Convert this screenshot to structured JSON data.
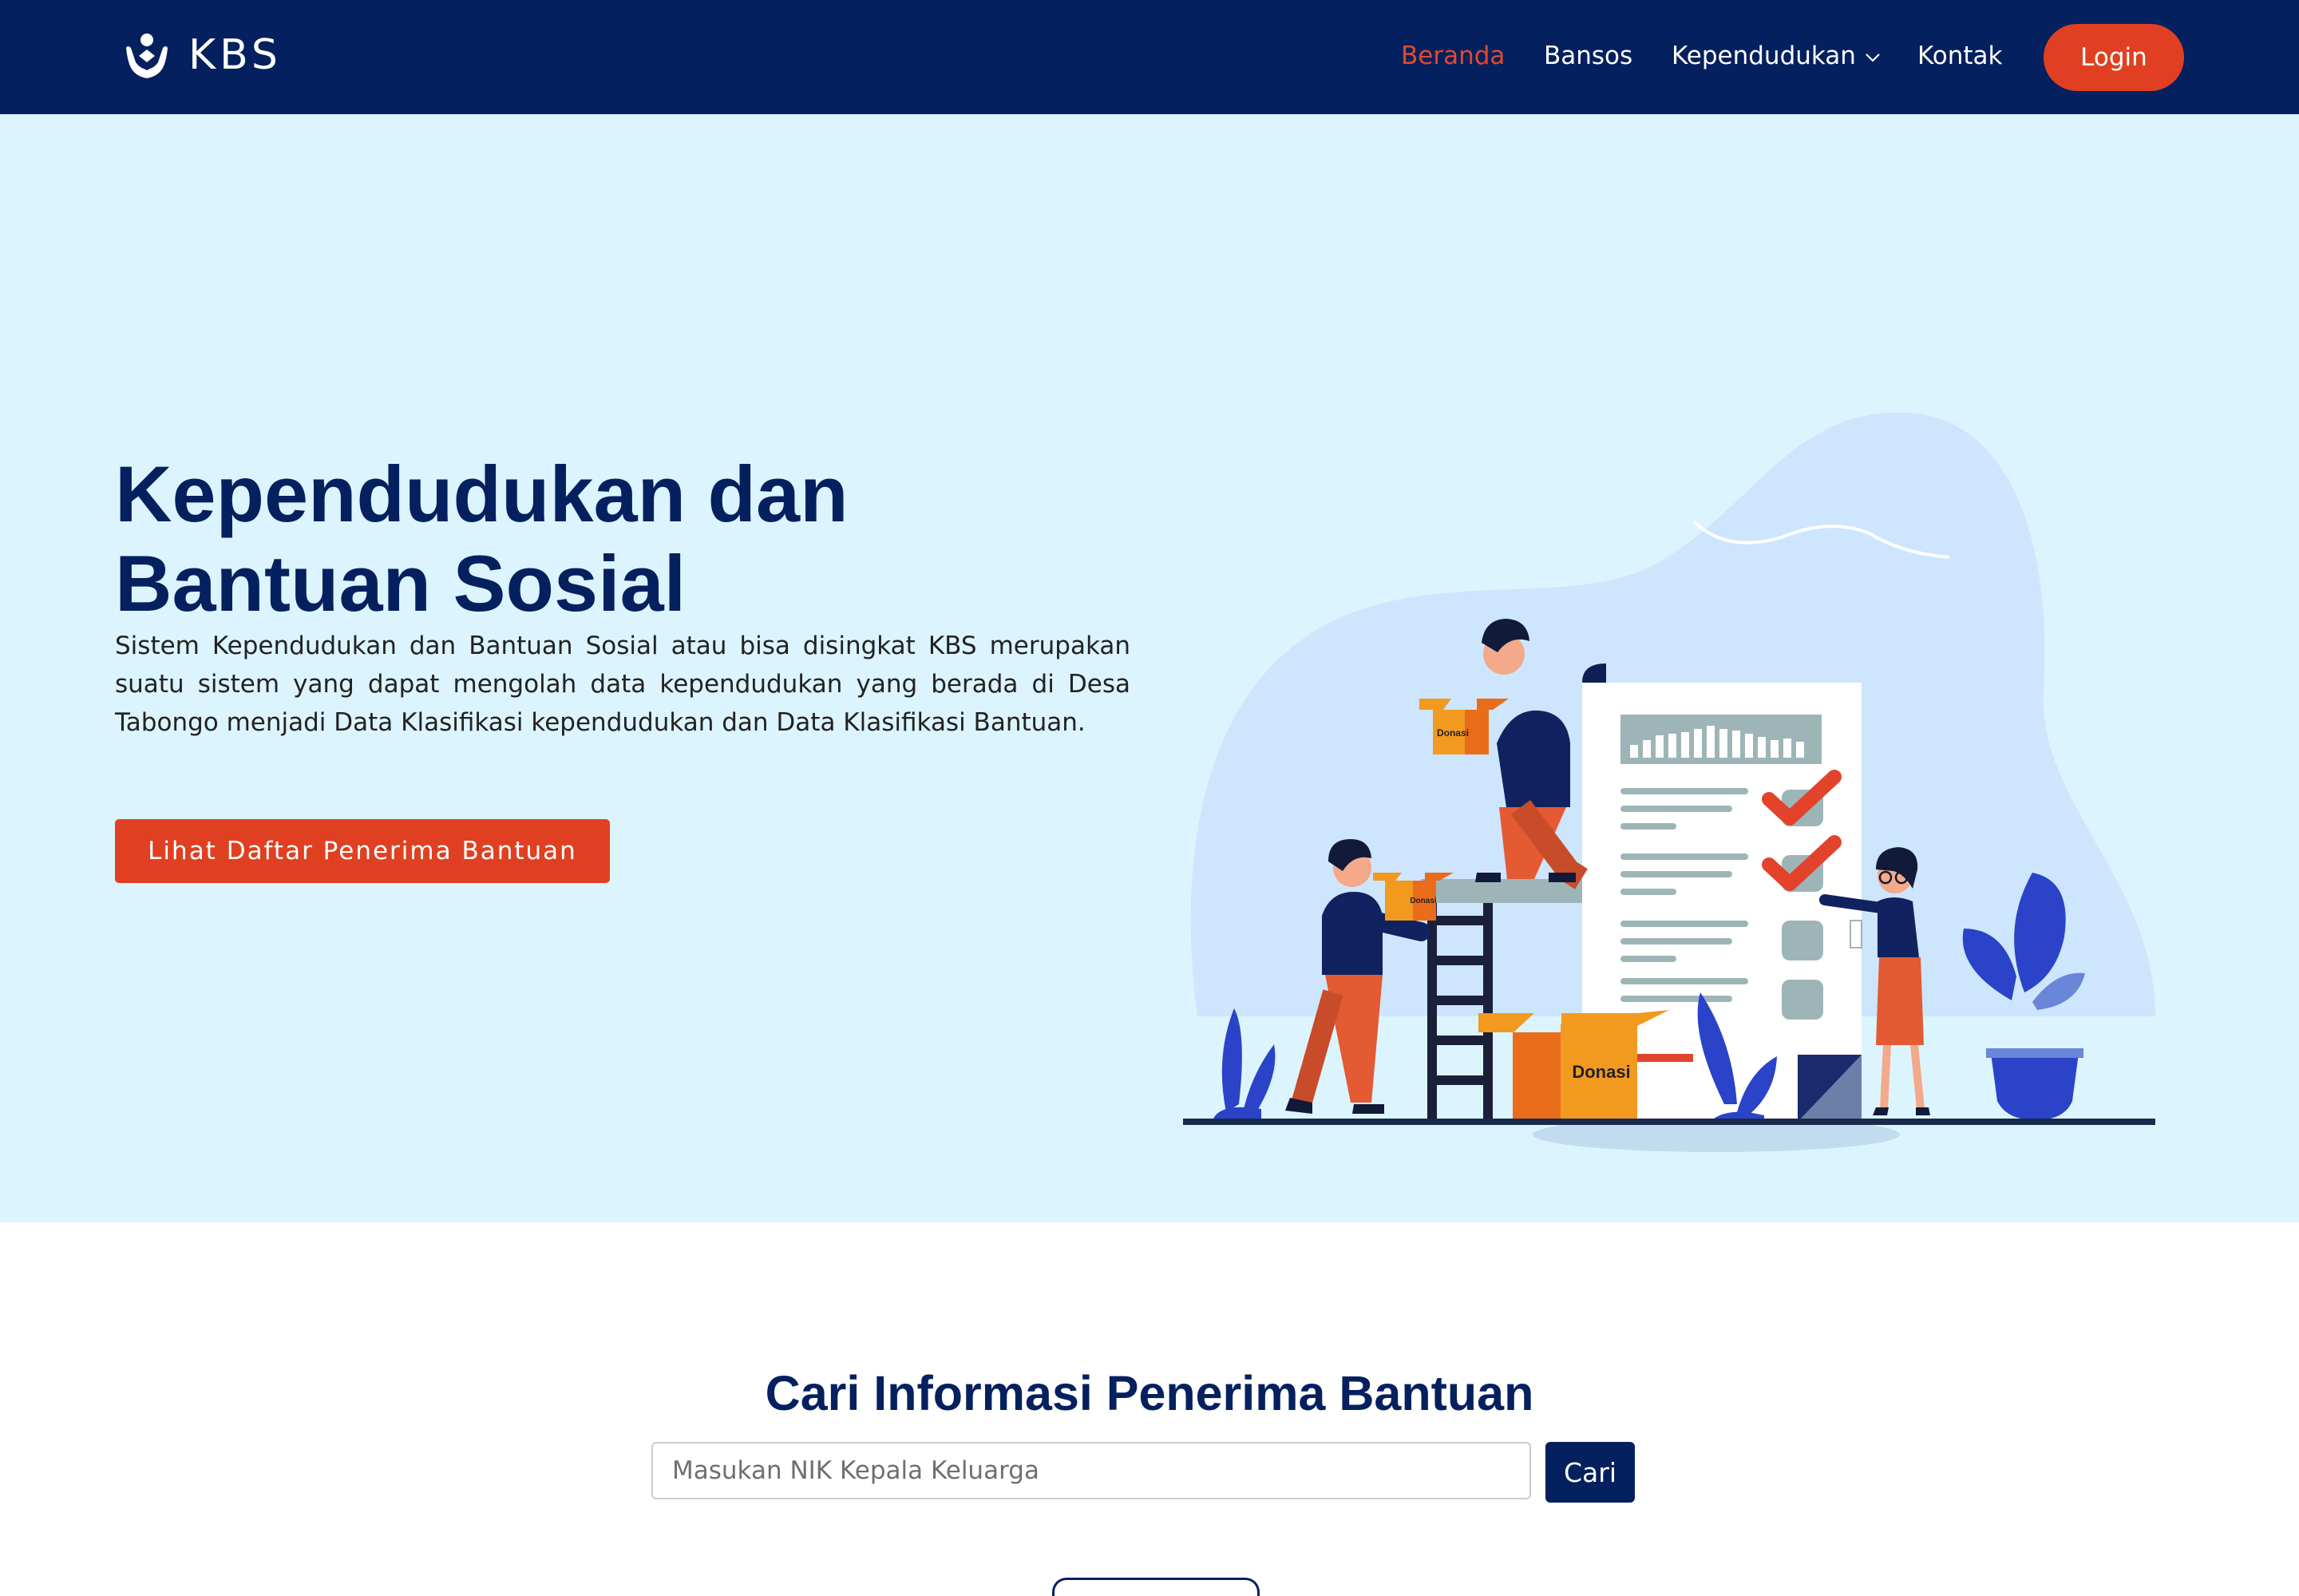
{
  "brand": {
    "name": "KBS",
    "logo_icon": "charity-hands-icon"
  },
  "nav": {
    "items": [
      {
        "label": "Beranda",
        "active": true
      },
      {
        "label": "Bansos",
        "active": false
      },
      {
        "label": "Kependudukan",
        "active": false,
        "dropdown": true
      },
      {
        "label": "Kontak",
        "active": false
      }
    ],
    "login_label": "Login"
  },
  "hero": {
    "title_line1": "Kependudukan dan",
    "title_line2": "Bantuan Sosial",
    "description": "Sistem Kependudukan dan Bantuan Sosial atau bisa disingkat KBS merupakan suatu sistem yang dapat mengolah data kependudukan yang berada di Desa Tabongo menjadi Data Klasifikasi kependudukan dan Data Klasifikasi Bantuan.",
    "button_label": "Lihat Daftar Penerima Bantuan",
    "illustration": {
      "box_label_small_1": "Donasi",
      "box_label_small_2": "Donasi",
      "box_label_large": "Donasi"
    }
  },
  "search": {
    "title": "Cari Informasi Penerima Bantuan",
    "placeholder": "Masukan NIK Kepala Keluarga",
    "button_label": "Cari"
  },
  "colors": {
    "navy": "#05205e",
    "accent": "#e04021",
    "hero_bg": "#dcf4fd",
    "active_nav": "#e04a2b"
  }
}
